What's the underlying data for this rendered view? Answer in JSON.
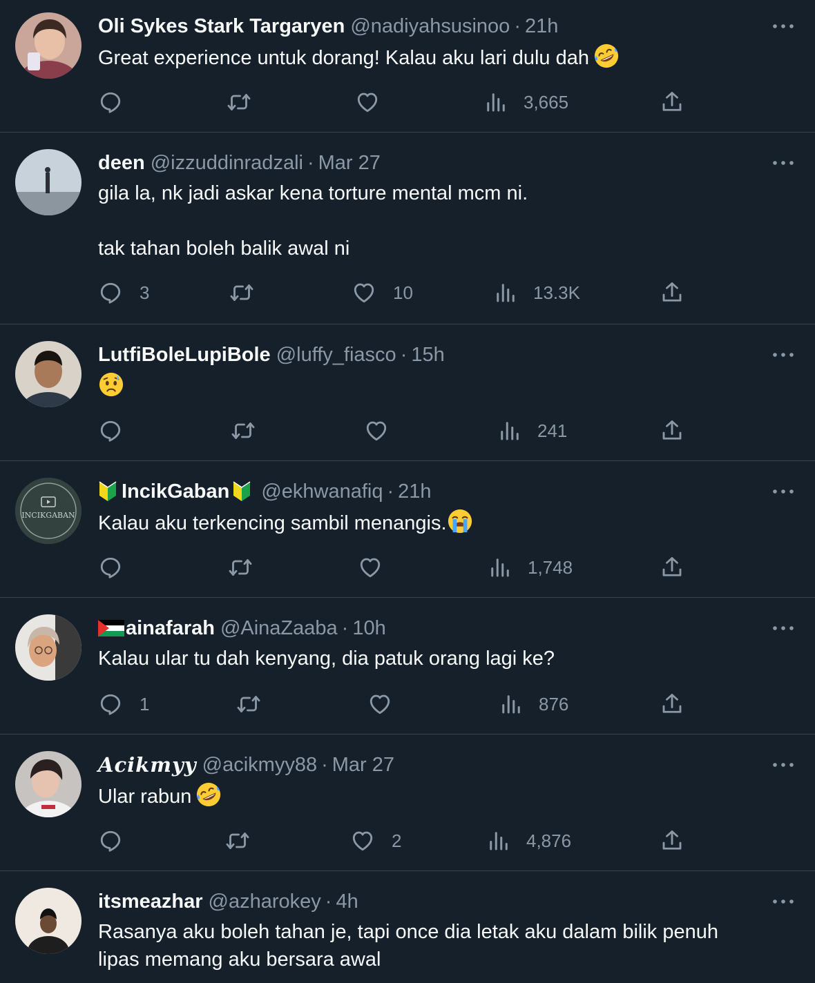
{
  "colors": {
    "background": "#15202b",
    "text": "#f7f9f9",
    "muted": "#8b98a5",
    "divider": "#38444d"
  },
  "icons": {
    "reply": "reply-icon",
    "retweet": "retweet-icon",
    "like": "heart-icon",
    "views": "views-icon",
    "share": "share-icon",
    "more": "more-icon"
  },
  "tweets": [
    {
      "name": "Oli Sykes Stark Targaryen",
      "handle": "@nadiyahsusinoo",
      "dot": "·",
      "time": "21h",
      "text": [
        "Great experience untuk dorang! Kalau aku lari dulu dah"
      ],
      "emoji": "rolling-on-floor-laughing-emoji",
      "replies": "",
      "retweets": "",
      "likes": "",
      "views": "3,665"
    },
    {
      "name": "deen",
      "handle": "@izzuddinradzali",
      "dot": "·",
      "time": "Mar 27",
      "text": [
        "gila la, nk jadi askar kena torture mental mcm ni.",
        "",
        "tak tahan boleh balik awal ni"
      ],
      "replies": "3",
      "retweets": "",
      "likes": "10",
      "views": "13.3K"
    },
    {
      "name": "LutfiBoleLupiBole",
      "handle": "@luffy_fiasco",
      "dot": "·",
      "time": "15h",
      "text": [
        ""
      ],
      "emoji": "anxious-face-emoji",
      "replies": "",
      "retweets": "",
      "likes": "",
      "views": "241"
    },
    {
      "name": "IncikGaban",
      "handle": "@ekhwanafiq",
      "dot": "·",
      "time": "21h",
      "text": [
        "Kalau aku terkencing sambil menangis."
      ],
      "emoji": "loudly-crying-face-emoji",
      "badge": "beginner-badge-icon",
      "avatar_text": "INCIKGABAN",
      "replies": "",
      "retweets": "",
      "likes": "",
      "views": "1,748"
    },
    {
      "name": "ainafarah",
      "handle": "@AinaZaaba",
      "dot": "·",
      "time": "10h",
      "text": [
        "Kalau ular tu dah kenyang, dia patuk orang lagi ke?"
      ],
      "flag": "palestine-flag-icon",
      "replies": "1",
      "retweets": "",
      "likes": "",
      "views": "876"
    },
    {
      "name": "Acikmyy",
      "handle": "@acikmyy88",
      "dot": "·",
      "time": "Mar 27",
      "text": [
        "Ular rabun"
      ],
      "emoji": "rolling-on-floor-laughing-emoji",
      "replies": "",
      "retweets": "",
      "likes": "2",
      "views": "4,876"
    },
    {
      "name": "itsmeazhar",
      "handle": "@azharokey",
      "dot": "·",
      "time": "4h",
      "text": [
        "Rasanya aku boleh tahan je, tapi once dia letak aku dalam bilik penuh",
        "lipas memang aku bersara awal"
      ],
      "replies": "",
      "retweets": "",
      "likes": "",
      "views": ""
    }
  ]
}
